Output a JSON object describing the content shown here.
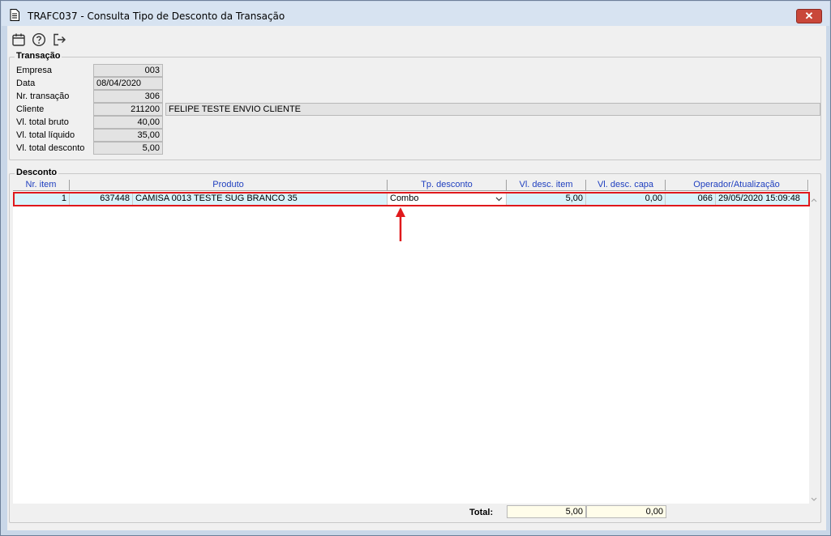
{
  "window": {
    "title": "TRAFC037 - Consulta Tipo de Desconto da Transação",
    "close_label": "✕"
  },
  "toolbar": {
    "icons": [
      "calendar-icon",
      "help-icon",
      "exit-icon"
    ]
  },
  "transacao": {
    "title": "Transação",
    "fields": [
      {
        "label": "Empresa",
        "value": "003"
      },
      {
        "label": "Data",
        "value": "08/04/2020"
      },
      {
        "label": "Nr. transação",
        "value": "306"
      },
      {
        "label": "Cliente",
        "value": "211200",
        "name": "FELIPE TESTE ENVIO CLIENTE"
      },
      {
        "label": "Vl. total bruto",
        "value": "40,00"
      },
      {
        "label": "Vl. total líquido",
        "value": "35,00"
      },
      {
        "label": "Vl. total desconto",
        "value": "5,00"
      }
    ]
  },
  "desconto": {
    "title": "Desconto",
    "columns": [
      "Nr. item",
      "Produto",
      "Tp. desconto",
      "Vl. desc. item",
      "Vl. desc. capa",
      "Operador/Atualização"
    ],
    "rows": [
      {
        "nr_item": "1",
        "produto_codigo": "637448",
        "produto_descricao": "CAMISA 0013 TESTE SUG BRANCO  35",
        "tp_desconto": "Combo",
        "vl_desc_item": "5,00",
        "vl_desc_capa": "0,00",
        "operador": "066",
        "atualizacao": "29/05/2020 15:09:48"
      }
    ],
    "total_label": "Total:",
    "total_item": "5,00",
    "total_capa": "0,00"
  },
  "colors": {
    "highlight": "#e0191c",
    "selected_row": "#d9f3fb",
    "header_text": "#1f3fbf"
  }
}
